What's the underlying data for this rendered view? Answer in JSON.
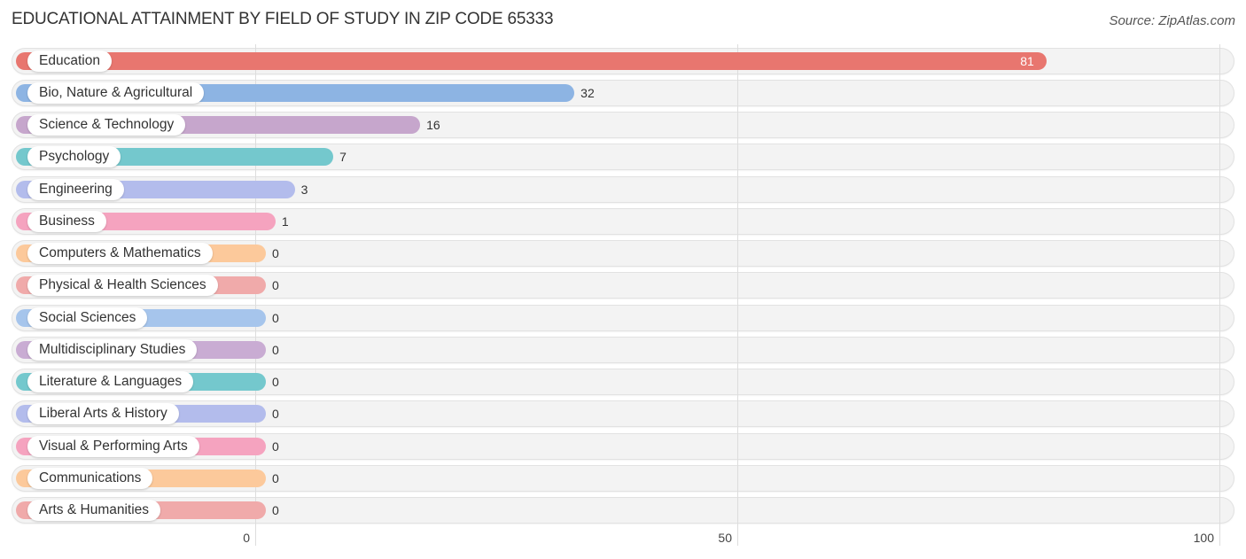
{
  "title": "EDUCATIONAL ATTAINMENT BY FIELD OF STUDY IN ZIP CODE 65333",
  "source": "Source: ZipAtlas.com",
  "chart_data": {
    "type": "bar",
    "orientation": "horizontal",
    "title": "EDUCATIONAL ATTAINMENT BY FIELD OF STUDY IN ZIP CODE 65333",
    "xlabel": "",
    "ylabel": "",
    "xlim": [
      0,
      100
    ],
    "x_ticks": [
      0,
      50,
      100
    ],
    "x_tick_labels": [
      "0",
      "50",
      "100"
    ],
    "grid": true,
    "categories": [
      "Education",
      "Bio, Nature & Agricultural",
      "Science & Technology",
      "Psychology",
      "Engineering",
      "Business",
      "Computers & Mathematics",
      "Physical & Health Sciences",
      "Social Sciences",
      "Multidisciplinary Studies",
      "Literature & Languages",
      "Liberal Arts & History",
      "Visual & Performing Arts",
      "Communications",
      "Arts & Humanities"
    ],
    "values": [
      81,
      32,
      16,
      7,
      3,
      1,
      0,
      0,
      0,
      0,
      0,
      0,
      0,
      0,
      0
    ],
    "value_labels": [
      "81",
      "32",
      "16",
      "7",
      "3",
      "1",
      "0",
      "0",
      "0",
      "0",
      "0",
      "0",
      "0",
      "0",
      "0"
    ],
    "colors": [
      "#e8766f",
      "#8db4e3",
      "#c6a6cc",
      "#74c8cd",
      "#b3bcec",
      "#f5a3bf",
      "#fcc99b",
      "#f0aaaa",
      "#a6c5ec",
      "#c9acd3",
      "#74c8cd",
      "#b3bcec",
      "#f5a3bf",
      "#fcc99b",
      "#f0aaaa"
    ]
  }
}
